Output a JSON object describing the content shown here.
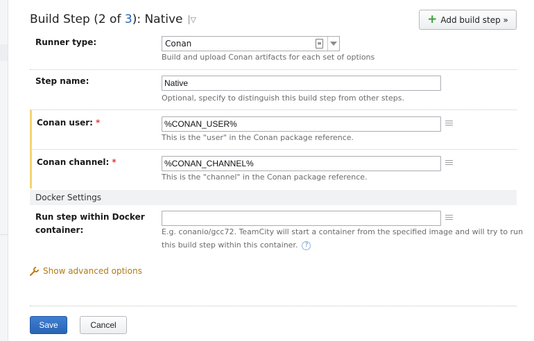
{
  "header": {
    "title_prefix": "Build Step (",
    "step_current": "2",
    "step_of": " of ",
    "step_total": "3",
    "title_suffix": "): Native",
    "menu_glyph": "▽",
    "add_step_plus": "+",
    "add_step_label": "Add build step »"
  },
  "runner": {
    "label": "Runner type:",
    "value": "Conan",
    "hint": "Build and upload Conan artifacts for each set of options"
  },
  "step_name": {
    "label": "Step name:",
    "value": "Native",
    "hint": "Optional, specify to distinguish this build step from other steps."
  },
  "conan_user": {
    "label": "Conan user:",
    "required_mark": "*",
    "value": "%CONAN_USER%",
    "hint": "This is the \"user\" in the Conan package reference."
  },
  "conan_channel": {
    "label": "Conan channel:",
    "required_mark": "*",
    "value": "%CONAN_CHANNEL%",
    "hint": "This is the \"channel\" in the Conan package reference."
  },
  "docker": {
    "section_title": "Docker Settings",
    "label_line1": "Run step within Docker",
    "label_line2": "container:",
    "value": "",
    "hint_line1": "E.g. conanio/gcc72. TeamCity will start a container from the specified image and will try to run",
    "hint_line2": "this build step within this container.",
    "help_glyph": "?"
  },
  "advanced_label": "Show advanced options",
  "actions": {
    "save": "Save",
    "cancel": "Cancel"
  },
  "colors": {
    "link": "#2063b8",
    "required_bar": "#f5d472",
    "primary_button": "#2f6dbf",
    "advanced_link": "#b07a15",
    "add_icon": "#3aa03e"
  },
  "icons": {
    "add": "plus-icon",
    "menu": "chevron-down-icon",
    "runner_info": "document-icon",
    "param": "list-icon",
    "help": "question-icon",
    "advanced": "wrench-icon"
  }
}
